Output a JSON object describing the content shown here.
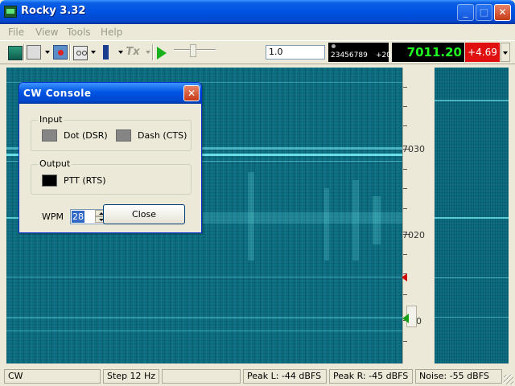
{
  "window": {
    "title": "Rocky 3.32",
    "minimize_glyph": "_",
    "maximize_glyph": "□",
    "close_glyph": "✕"
  },
  "menu": {
    "items": [
      "File",
      "View",
      "Tools",
      "Help"
    ]
  },
  "toolbar": {
    "icons": [
      "spectrum-icon",
      "waterfall-icon",
      "record-icon",
      "tape-icon",
      "microphone-icon",
      "tx-icon",
      "play-icon"
    ],
    "tx_label": "Tx",
    "gain_value": "1.0",
    "mini_display_digits": "23456789",
    "mini_display_offset": "+20",
    "frequency": "7011.20",
    "rit_offset": "+4.69"
  },
  "scale": {
    "labels": [
      "7030",
      "7020",
      "0"
    ]
  },
  "dialog": {
    "title": "CW Console",
    "close_glyph": "✕",
    "input_group_label": "Input",
    "dot_label": "Dot (DSR)",
    "dash_label": "Dash (CTS)",
    "output_group_label": "Output",
    "ptt_label": "PTT (RTS)",
    "wpm_label": "WPM",
    "wpm_value": "28",
    "close_button_label": "Close"
  },
  "status": {
    "mode": "CW",
    "step": "Step 12 Hz",
    "peak_l": "Peak L: -44 dBFS",
    "peak_r": "Peak R: -45 dBFS",
    "noise": "Noise: -55 dBFS"
  }
}
